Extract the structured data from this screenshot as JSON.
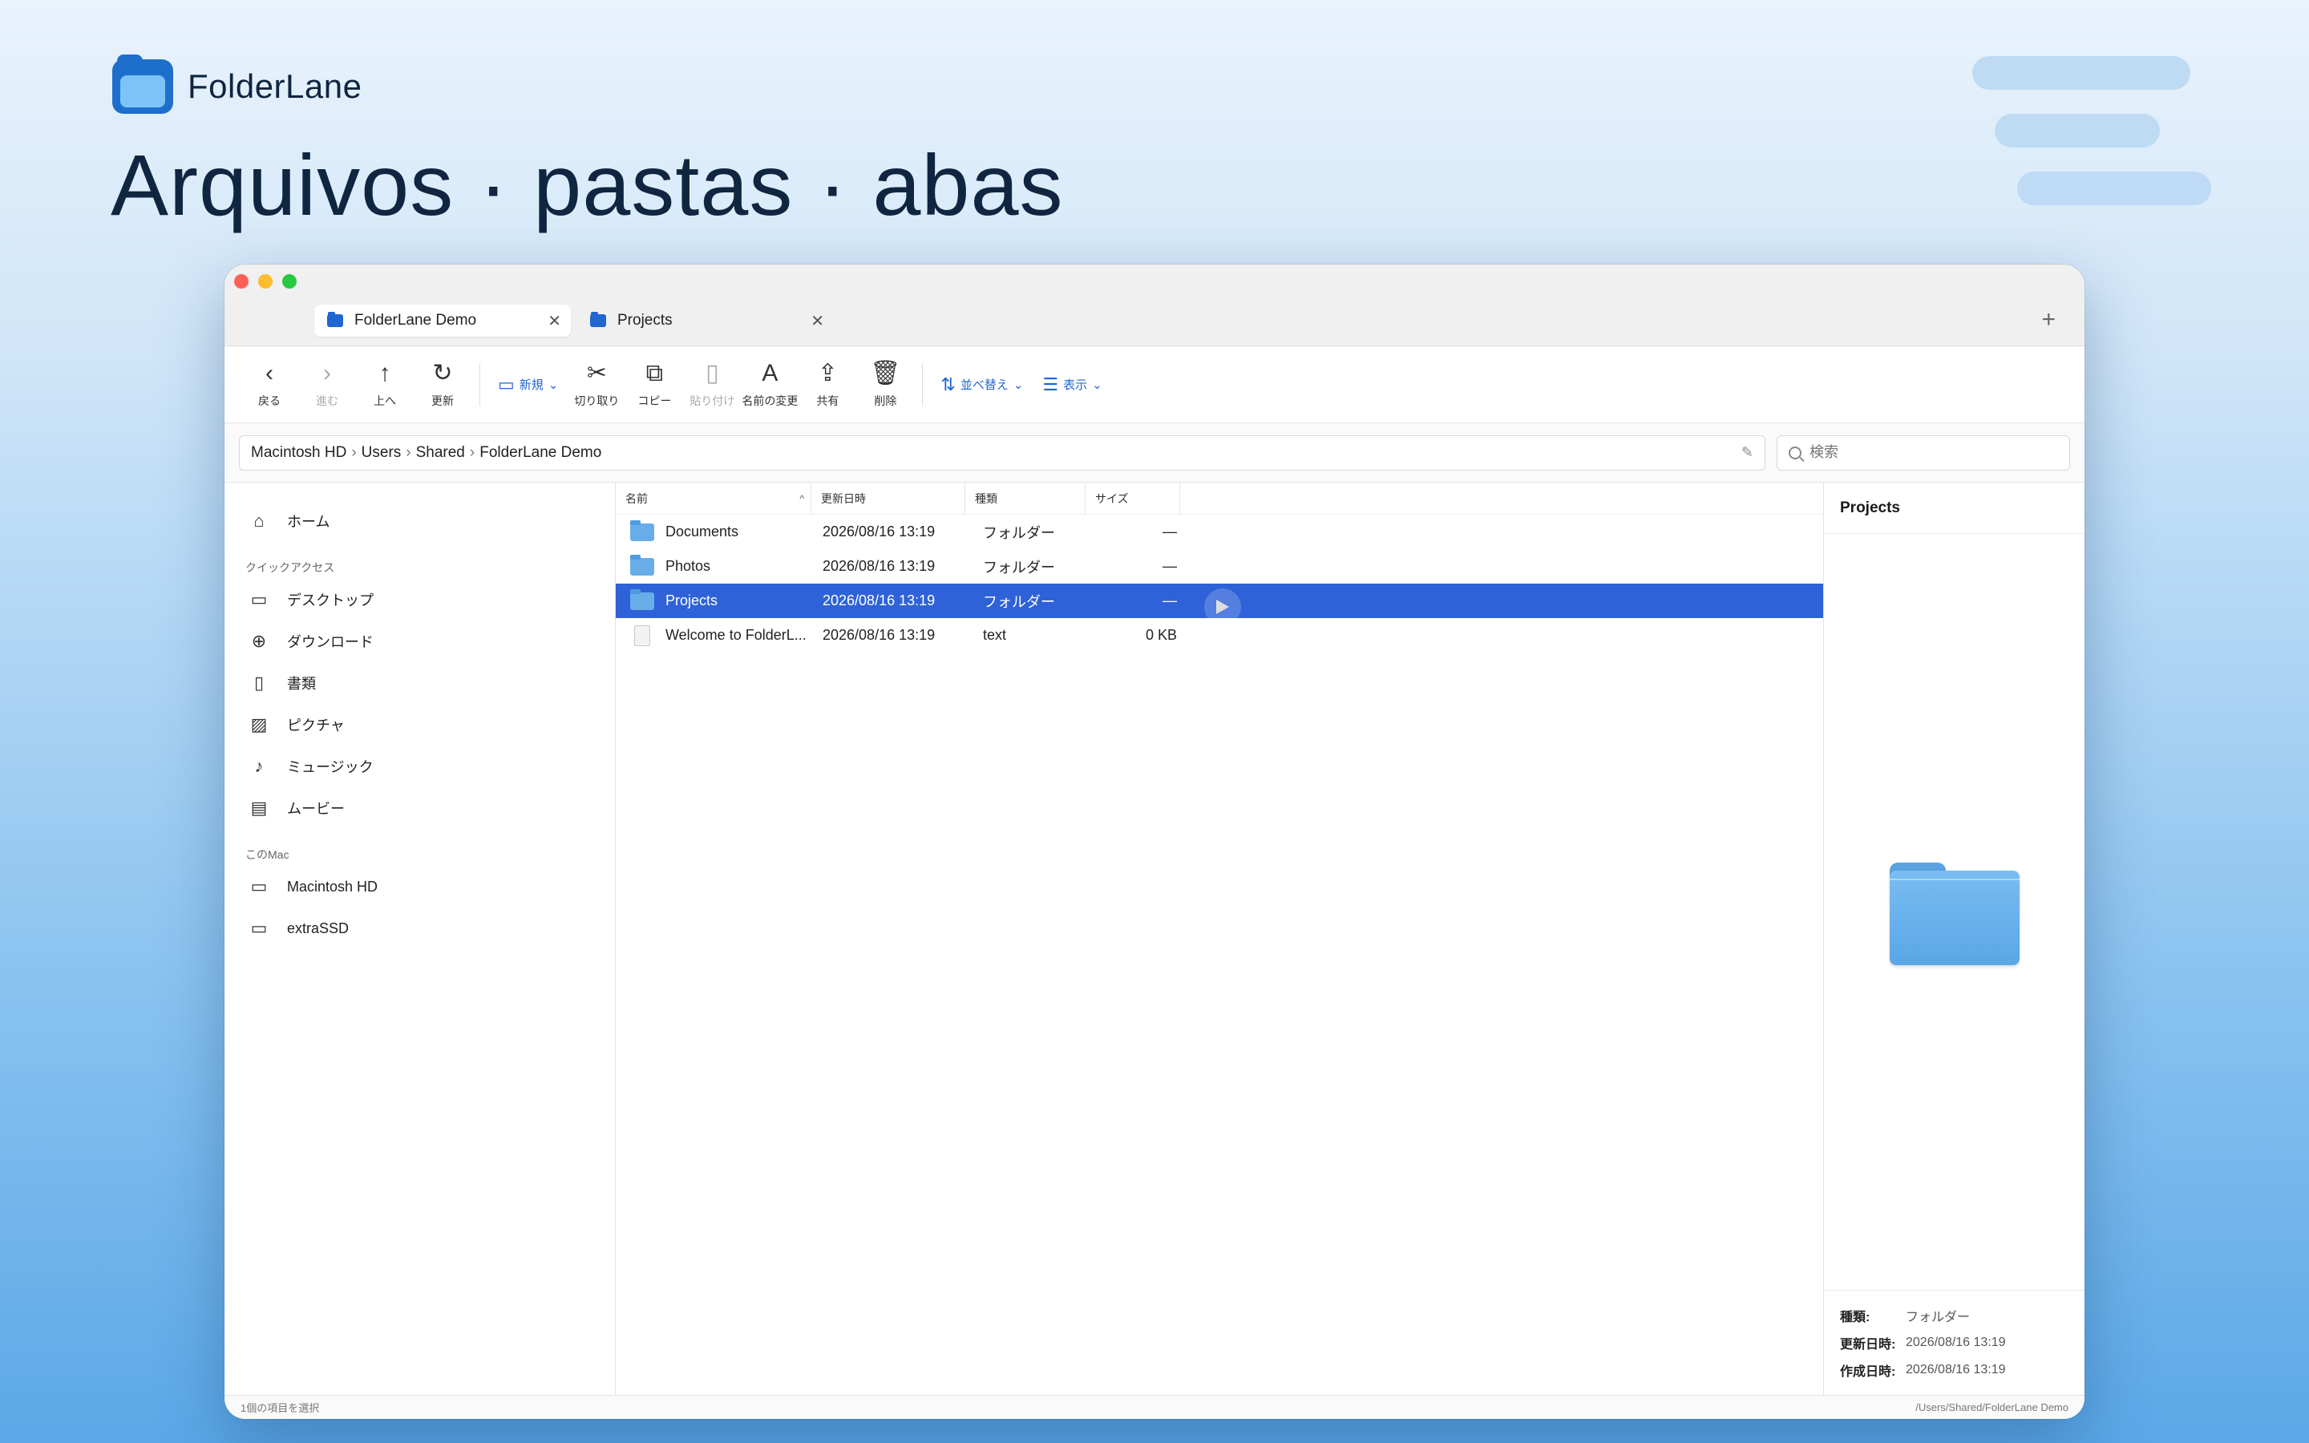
{
  "brand": {
    "name": "FolderLane"
  },
  "headline": "Arquivos · pastas · abas",
  "window": {
    "tabs": [
      {
        "label": "FolderLane Demo",
        "active": true
      },
      {
        "label": "Projects",
        "active": false
      }
    ],
    "new_tab": "+",
    "toolbar": {
      "back": "戻る",
      "forward": "進む",
      "up": "上へ",
      "refresh": "更新",
      "new": "新規",
      "cut": "切り取り",
      "copy": "コピー",
      "paste": "貼り付け",
      "rename": "名前の変更",
      "share": "共有",
      "delete": "削除",
      "sort": "並べ替え",
      "view": "表示"
    },
    "address": {
      "crumbs": [
        "Macintosh HD",
        "Users",
        "Shared",
        "FolderLane Demo"
      ]
    },
    "search": {
      "placeholder": "検索"
    },
    "sidebar": {
      "home": "ホーム",
      "quick_access_header": "クイックアクセス",
      "quick_access": [
        "デスクトップ",
        "ダウンロード",
        "書類",
        "ピクチャ",
        "ミュージック",
        "ムービー"
      ],
      "this_mac_header": "このMac",
      "drives": [
        "Macintosh HD",
        "extraSSD"
      ]
    },
    "columns": {
      "name": "名前",
      "date": "更新日時",
      "kind": "種類",
      "size": "サイズ"
    },
    "files": [
      {
        "name": "Documents",
        "date": "2026/08/16 13:19",
        "kind": "フォルダー",
        "size": "—",
        "type": "folder"
      },
      {
        "name": "Photos",
        "date": "2026/08/16 13:19",
        "kind": "フォルダー",
        "size": "—",
        "type": "folder"
      },
      {
        "name": "Projects",
        "date": "2026/08/16 13:19",
        "kind": "フォルダー",
        "size": "—",
        "type": "folder",
        "selected": true
      },
      {
        "name": "Welcome to FolderL...",
        "date": "2026/08/16 13:19",
        "kind": "text",
        "size": "0 KB",
        "type": "file"
      }
    ],
    "preview": {
      "title": "Projects",
      "kind_label": "種類:",
      "kind_value": "フォルダー",
      "modified_label": "更新日時:",
      "modified_value": "2026/08/16 13:19",
      "created_label": "作成日時:",
      "created_value": "2026/08/16 13:19"
    },
    "status": {
      "selection": "1個の項目を選択",
      "path": "/Users/Shared/FolderLane Demo"
    }
  },
  "colors": {
    "accent": "#2f62d8",
    "brand": "#1e6fcc",
    "headline": "#0f2540"
  }
}
